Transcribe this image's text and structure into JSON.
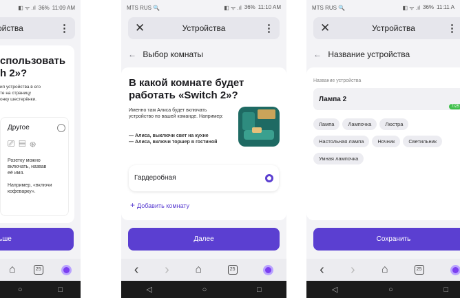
{
  "screen1": {
    "status_time": "11:09 AM",
    "status_battery": "36%",
    "title": "ойства",
    "heading": "спользовать\nh 2»?",
    "desc": "ип устройства в его\nте на страницу\nонку шестерёнки.",
    "option_label": "Другое",
    "option_desc": "Розетку можно\nвключать, назвав\nеё имя.",
    "option_example": "Например, «включи\nкофеварку».",
    "button": "ьше"
  },
  "screen2": {
    "carrier": "MTS RUS",
    "status_time": "11:10 AM",
    "status_battery": "36%",
    "title": "Устройства",
    "header": "Выбор комнаты",
    "heading": "В какой комнате будет работать «Switch 2»?",
    "desc": "Именно там Алиса будет включать устройство по вашей команде. Например:",
    "example1": "— Алиса, выключи свет на кухне",
    "example2": "— Алиса, включи торшер в гостиной",
    "room": "Гардеробная",
    "add_room": "Добавить комнату",
    "button": "Далее"
  },
  "screen3": {
    "carrier": "MTS RUS",
    "status_time": "11:11 A",
    "status_battery": "36%",
    "title": "Устройства",
    "header": "Название устройства",
    "field_label": "Название устройства",
    "field_value": "Лампа 2",
    "counter": "7/25",
    "chips": [
      "Лампа",
      "Лампочка",
      "Люстра",
      "Настольная лампа",
      "Ночник",
      "Светильник",
      "Умная лампочка"
    ],
    "button": "Сохранить"
  },
  "nav": {
    "back": "‹",
    "forward": "›",
    "home": "⌂",
    "calendar": "25"
  },
  "sys": {
    "back": "◁",
    "home": "○",
    "recent": "□"
  },
  "colors": {
    "accent": "#5b3fd1",
    "chip_bg": "#ececf1",
    "counter_bg": "#3fbf4a"
  }
}
